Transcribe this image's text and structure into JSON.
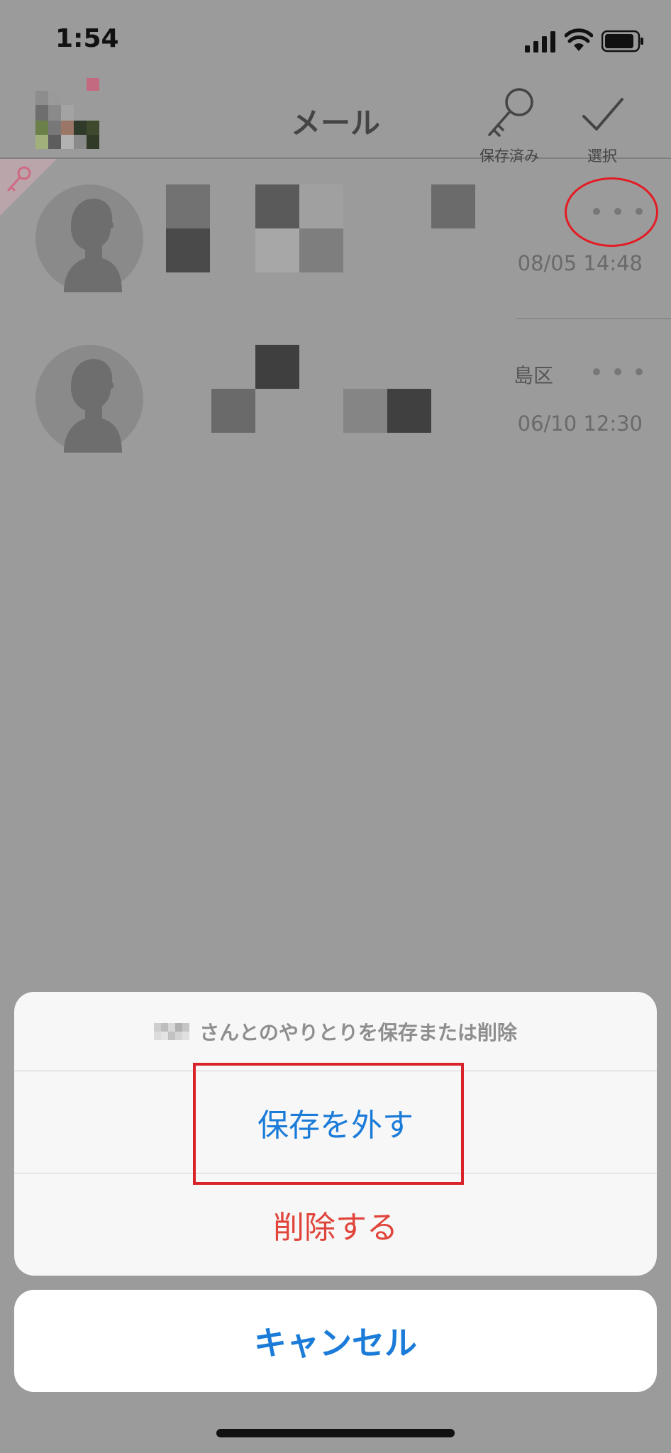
{
  "status_bar": {
    "time": "1:54",
    "icons": [
      "signal-icon",
      "wifi-icon",
      "battery-icon"
    ]
  },
  "nav": {
    "title": "メール",
    "saved_label": "保存済み",
    "select_label": "選択",
    "icons": [
      "key-icon",
      "checkmark-icon"
    ]
  },
  "mail_list": [
    {
      "date": "08/05 14:48",
      "saved": true,
      "location": ""
    },
    {
      "date": "06/10 12:30",
      "saved": false,
      "location": "島区"
    }
  ],
  "action_sheet": {
    "message": "さんとのやりとりを保存または削除",
    "unsave_label": "保存を外す",
    "delete_label": "削除する",
    "cancel_label": "キャンセル"
  },
  "colors": {
    "action_blue": "#1a7bd8",
    "destructive_red": "#e0443a",
    "annotation_red": "#e41b23",
    "overlay_gray": "#9b9b9b"
  }
}
